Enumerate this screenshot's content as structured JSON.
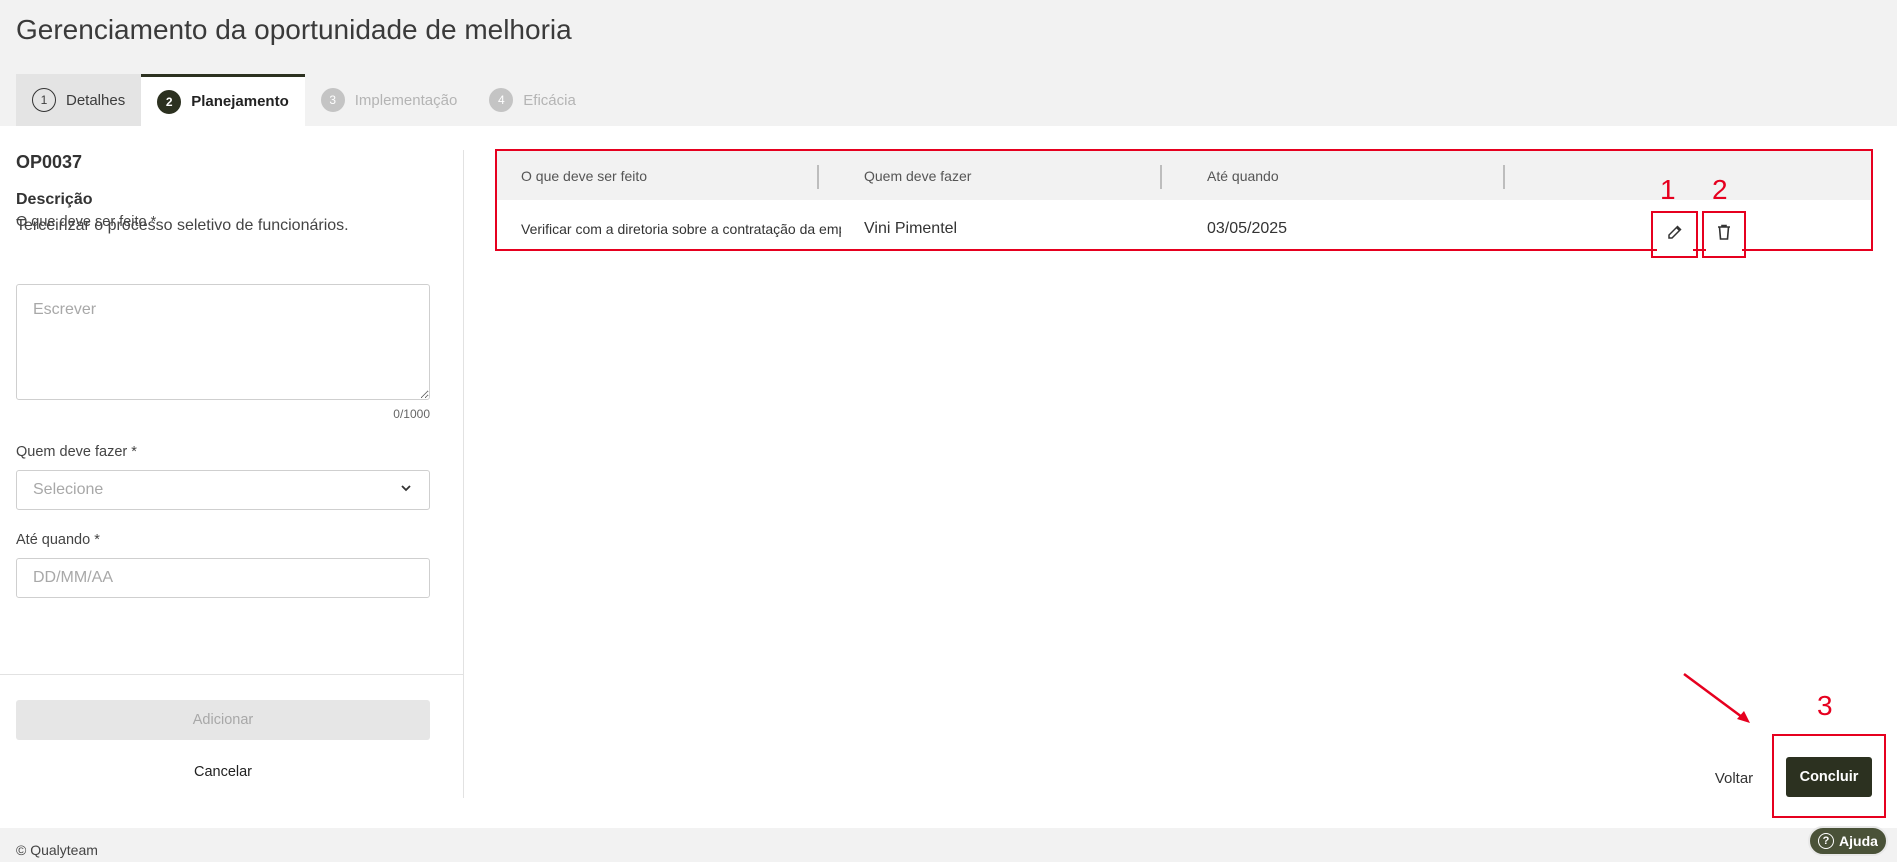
{
  "page": {
    "title": "Gerenciamento da oportunidade de melhoria"
  },
  "tabs": [
    {
      "number": "1",
      "label": "Detalhes",
      "state": "done"
    },
    {
      "number": "2",
      "label": "Planejamento",
      "state": "active"
    },
    {
      "number": "3",
      "label": "Implementação",
      "state": "disabled"
    },
    {
      "number": "4",
      "label": "Eficácia",
      "state": "disabled"
    }
  ],
  "form": {
    "code": "OP0037",
    "description_label": "Descrição",
    "description_text": "Terceirizar o processo seletivo de funcionários.",
    "what_label": "O que deve ser feito *",
    "what_placeholder": "Escrever",
    "what_value": "",
    "what_counter": "0/1000",
    "who_label": "Quem deve fazer *",
    "who_placeholder": "Selecione",
    "when_label": "Até quando *",
    "when_placeholder": "DD/MM/AA",
    "add_button": "Adicionar",
    "cancel_button": "Cancelar"
  },
  "table": {
    "columns": [
      "O que deve ser feito",
      "Quem deve fazer",
      "Até quando"
    ],
    "rows": [
      {
        "what": "Verificar com a diretoria sobre a contratação da empresa",
        "who": "Vini Pimentel",
        "when": "03/05/2025"
      }
    ],
    "edit_icon": "pencil-icon",
    "delete_icon": "trash-icon"
  },
  "annotations": [
    "1",
    "2",
    "3"
  ],
  "actions": {
    "back_button": "Voltar",
    "conclude_button": "Concluir"
  },
  "footer": {
    "copyright": "© Qualyteam",
    "help_button": "Ajuda",
    "help_icon": "question-circle-icon"
  },
  "colors": {
    "primary": "#2c3120",
    "annotation": "#e6001f",
    "background": "#f2f2f2"
  }
}
